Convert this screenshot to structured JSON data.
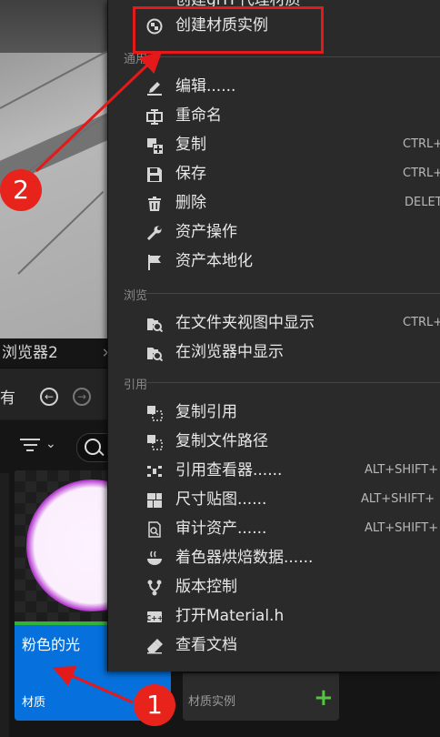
{
  "menu": {
    "top_partial_label": "创建glTF代理材质",
    "create_instance_label": "创建材质实例",
    "sections": [
      {
        "label": "通用"
      },
      {
        "label": "浏览"
      },
      {
        "label": "引用"
      }
    ],
    "items": [
      {
        "label": "编辑......",
        "icon": "pencil-icon",
        "shortcut": ""
      },
      {
        "label": "重命名",
        "icon": "rename-icon",
        "shortcut": ""
      },
      {
        "label": "复制",
        "icon": "duplicate-icon",
        "shortcut": "CTRL+"
      },
      {
        "label": "保存",
        "icon": "save-icon",
        "shortcut": "CTRL+"
      },
      {
        "label": "删除",
        "icon": "trash-icon",
        "shortcut": "DELET"
      },
      {
        "label": "资产操作",
        "icon": "wrench-icon",
        "shortcut": ""
      },
      {
        "label": "资产本地化",
        "icon": "flag-icon",
        "shortcut": ""
      },
      {
        "label": "在文件夹视图中显示",
        "icon": "folder-search-icon",
        "shortcut": "CTRL+"
      },
      {
        "label": "在浏览器中显示",
        "icon": "folder-search-icon",
        "shortcut": ""
      },
      {
        "label": "复制引用",
        "icon": "copy-reference-icon",
        "shortcut": ""
      },
      {
        "label": "复制文件路径",
        "icon": "copy-path-icon",
        "shortcut": ""
      },
      {
        "label": "引用查看器......",
        "icon": "reference-viewer-icon",
        "shortcut": "ALT+SHIFT+"
      },
      {
        "label": "尺寸贴图......",
        "icon": "size-map-icon",
        "shortcut": "ALT+SHIFT+"
      },
      {
        "label": "审计资产......",
        "icon": "audit-icon",
        "shortcut": "ALT+SHIFT+"
      },
      {
        "label": "着色器烘焙数据......",
        "icon": "shader-bowl-icon",
        "shortcut": ""
      },
      {
        "label": "版本控制",
        "icon": "branch-icon",
        "shortcut": ""
      },
      {
        "label": "打开Material.h",
        "icon": "cpp-icon",
        "shortcut": ""
      },
      {
        "label": "查看文档",
        "icon": "eraser-doc-icon",
        "shortcut": ""
      }
    ]
  },
  "content_browser": {
    "tab_label": "浏览器2",
    "tab_close": "×",
    "toolbar_text": "有",
    "asset": {
      "name": "粉色的光",
      "type": "材质"
    },
    "asset2": {
      "type": "材质实例",
      "plus": "+"
    }
  },
  "annotations": {
    "marker1": "1",
    "marker2": "2",
    "color": "#e41919"
  }
}
